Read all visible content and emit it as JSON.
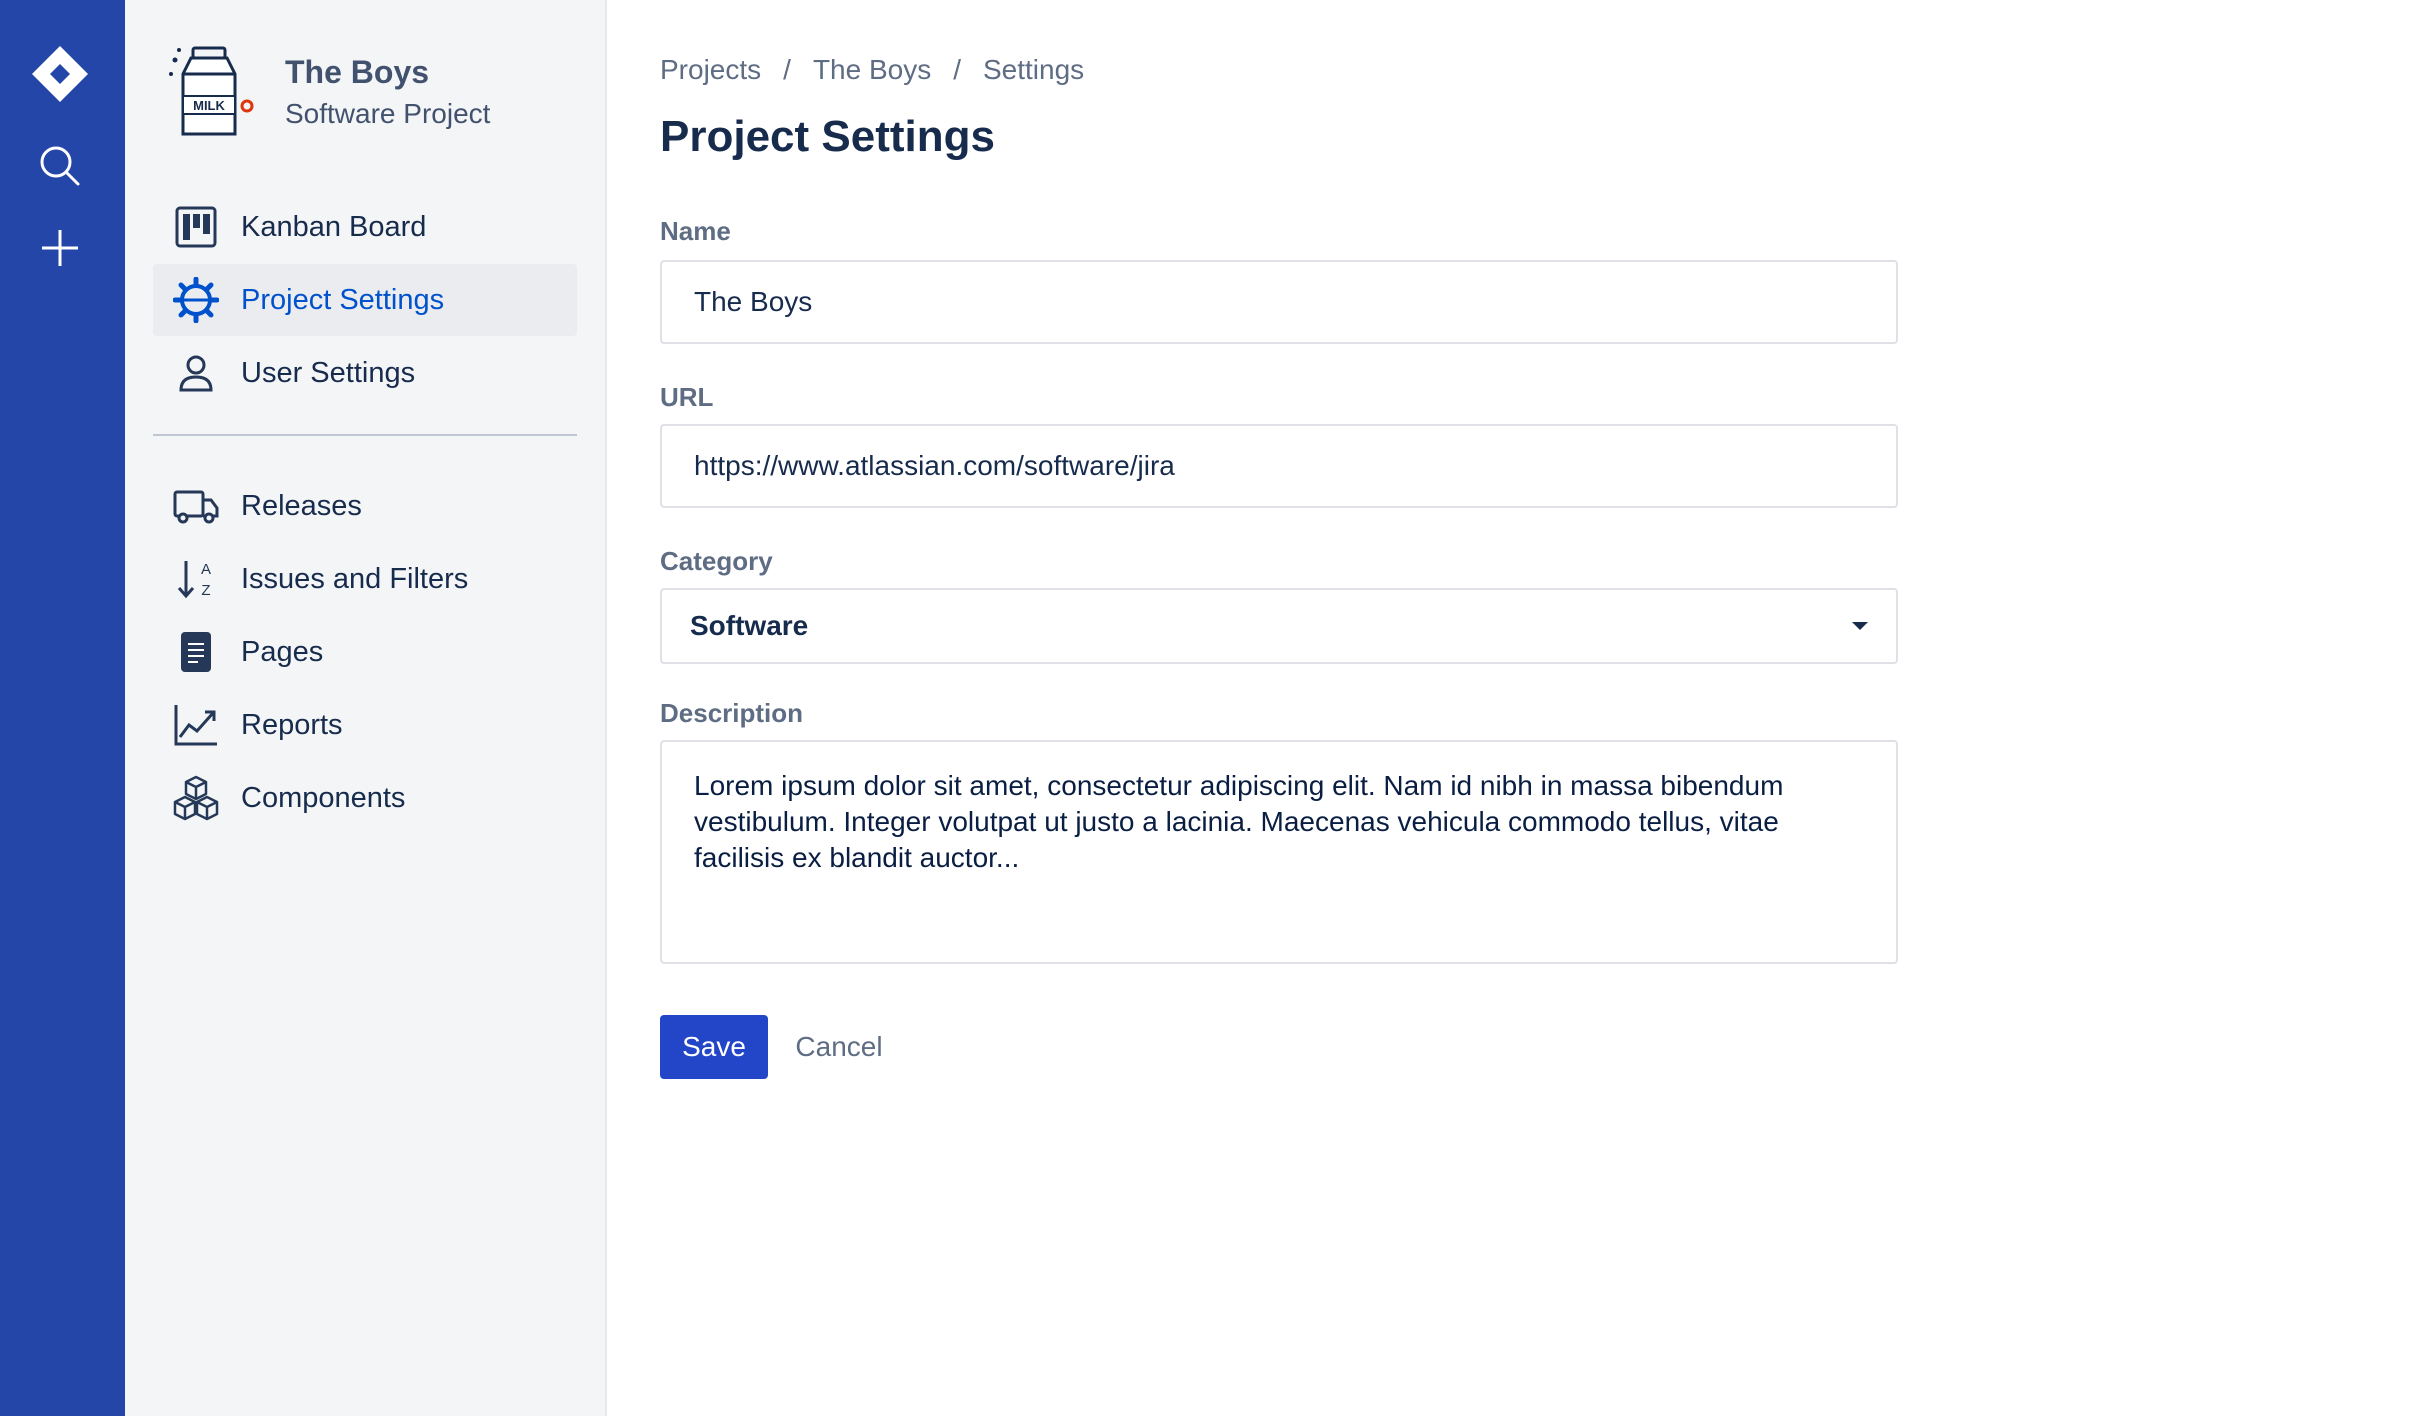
{
  "global_nav": {
    "icons": [
      "jira-logo-icon",
      "search-icon",
      "plus-icon"
    ],
    "bg_color": "#2346a8"
  },
  "sidebar": {
    "project": {
      "name": "The Boys",
      "type": "Software Project",
      "avatar_icon": "milk-carton-icon",
      "avatar_text": "MILK"
    },
    "items": [
      {
        "label": "Kanban Board",
        "icon": "kanban-board-icon",
        "active": false
      },
      {
        "label": "Project Settings",
        "icon": "gear-icon",
        "active": true
      },
      {
        "label": "User Settings",
        "icon": "user-icon",
        "active": false
      },
      {
        "label": "Releases",
        "icon": "truck-icon",
        "active": false
      },
      {
        "label": "Issues and Filters",
        "icon": "sort-az-icon",
        "active": false
      },
      {
        "label": "Pages",
        "icon": "page-icon",
        "active": false
      },
      {
        "label": "Reports",
        "icon": "chart-line-icon",
        "active": false
      },
      {
        "label": "Components",
        "icon": "cubes-icon",
        "active": false
      }
    ]
  },
  "breadcrumb": {
    "items": [
      "Projects",
      "The Boys",
      "Settings"
    ],
    "separator": "/"
  },
  "page": {
    "title": "Project Settings"
  },
  "form": {
    "name_label": "Name",
    "name_value": "The Boys",
    "url_label": "URL",
    "url_value": "https://www.atlassian.com/software/jira",
    "category_label": "Category",
    "category_value": "Software",
    "description_label": "Description",
    "description_value": "Lorem ipsum dolor sit amet, consectetur adipiscing elit. Nam id nibh in massa bibendum vestibulum. Integer volutpat ut justo a lacinia. Maecenas vehicula commodo tellus, vitae facilisis ex blandit auctor...",
    "save_label": "Save",
    "cancel_label": "Cancel"
  },
  "colors": {
    "primary": "#2346c9",
    "link_active": "#0052cc",
    "text": "#172b4d",
    "subtle": "#5e6c84"
  }
}
